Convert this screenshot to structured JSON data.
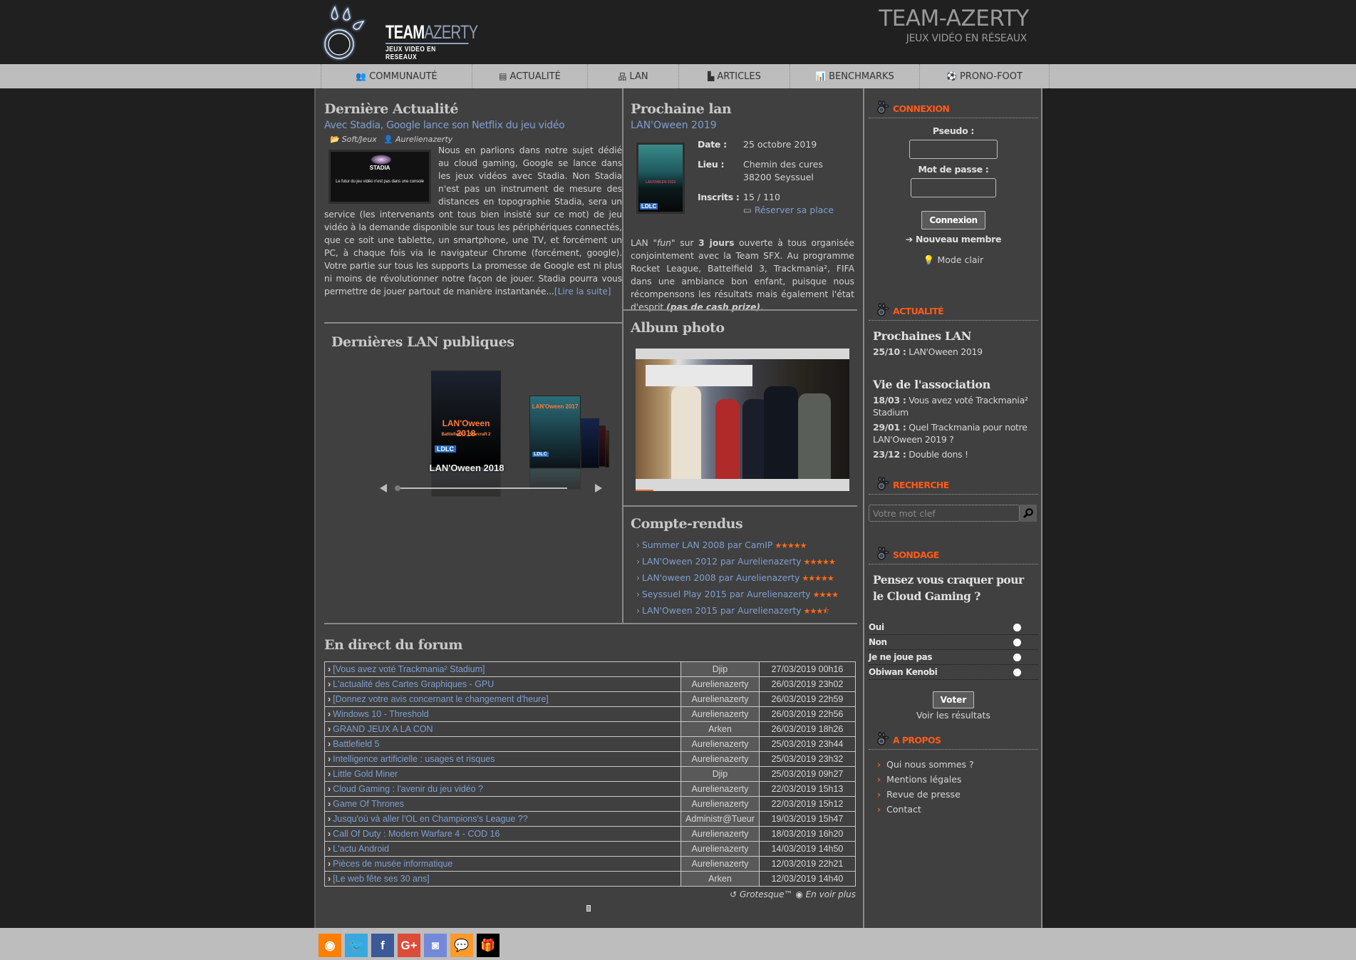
{
  "header": {
    "logo_word_team": "TEAM",
    "logo_word_azerty": "AZERTY",
    "logo_tagline": "JEUX VIDEO EN RESEAUX",
    "site_title": "TEAM-AZERTY",
    "site_subtitle": "JEUX VIDÉO EN RÉSEAUX"
  },
  "nav": {
    "items": [
      {
        "label": "COMMUNAUTÉ",
        "icon": "users-icon",
        "glyph": "👥"
      },
      {
        "label": "ACTUALITÉ",
        "icon": "newspaper-icon",
        "glyph": "▤"
      },
      {
        "label": "LAN",
        "icon": "sitemap-icon",
        "glyph": "品"
      },
      {
        "label": "ARTICLES",
        "icon": "book-reader-icon",
        "glyph": "▙"
      },
      {
        "label": "BENCHMARKS",
        "icon": "bar-chart-icon",
        "glyph": "📊"
      },
      {
        "label": "PRONO-FOOT",
        "icon": "soccer-ball-icon",
        "glyph": "⚽"
      }
    ]
  },
  "news": {
    "section_title": "Dernière Actualité",
    "headline": "Avec Stadia, Google lance son Netflix du jeu vidéo",
    "category": "Soft/Jeux",
    "author": "Aurelienazerty",
    "thumb_logo": "STADIA",
    "thumb_caption": "Le futur du jeu vidéo n'est pas dans une console",
    "body": "Nous en parlions dans notre sujet dédié au cloud gaming, Google se lance dans les jeux vidéos avec Stadia. Non Stadia n'est pas un instrument de mesure des distances en topographie Stadia, sera un service (les intervenants ont tous bien insisté sur ce mot) de jeu vidéo à la demande disponible sur tous les périphériques connectés, que ce soit une tablette, un smartphone, une TV, et forcément un PC, à chaque fois via le navigateur Chrome (forcément, google). Votre partie sur tous les supports La promesse de Google est ni plus ni moins de révolutionner notre façon de jouer. Stadia pourra vous permettre de jouer partout de manière instantanée...",
    "read_more": "[Lire la suite]"
  },
  "public_lans": {
    "section_title": "Dernières LAN publiques",
    "current_caption": "LAN'Oween 2018",
    "posters": [
      {
        "title": "LAN'Oween 2018"
      },
      {
        "title": "LAN'Oween 2017"
      }
    ]
  },
  "next_lan": {
    "section_title": "Prochaine lan",
    "name": "LAN'Oween 2019",
    "date_label": "Date :",
    "date_value": "25 octobre 2019",
    "place_label": "Lieu :",
    "place_line1": "Chemin des cures",
    "place_line2": "38200 Seyssuel",
    "registered_label": "Inscrits :",
    "registered_value": "15 / 110",
    "reserve_label": "Réserver sa place",
    "poster_title": "LAN'OWEEN 2019",
    "poster_sponsor": "LDLC",
    "desc_1": "LAN ",
    "desc_fun": "\"fun\"",
    "desc_2": " sur ",
    "desc_days": "3 jours",
    "desc_3": " ouverte à tous organisée conjointement avec la Team SFX. Au programme Rocket League, Battelfield 3, Trackmania², FIFA dans une ambiance bon enfant, puisque nous récompensons les résultats mais également l'état d'esprit ",
    "desc_cash": "(pas de cash prize)",
    "desc_end": "."
  },
  "album": {
    "section_title": "Album photo"
  },
  "reports": {
    "section_title": "Compte-rendus",
    "items": [
      {
        "label": "Summer LAN 2008 par CamIP",
        "rating": 5,
        "stars": "★★★★★"
      },
      {
        "label": "LAN'Oween 2012 par Aurelienazerty",
        "rating": 5,
        "stars": "★★★★★"
      },
      {
        "label": "LAN'oween 2008 par Aurelienazerty",
        "rating": 5,
        "stars": "★★★★★"
      },
      {
        "label": "Seyssuel Play 2015 par Aurelienazerty",
        "rating": 4,
        "stars": "★★★★"
      },
      {
        "label": "LAN'Oween 2015 par Aurelienazerty",
        "rating": 3.5,
        "stars": "★★★⯪"
      }
    ]
  },
  "forum": {
    "section_title": "En direct du forum",
    "rows": [
      {
        "topic": "[Vous avez voté Trackmania² Stadium]",
        "author": "Djip",
        "date": "27/03/2019 00h16"
      },
      {
        "topic": "L'actualité des Cartes Graphiques - GPU",
        "author": "Aurelienazerty",
        "date": "26/03/2019 23h02"
      },
      {
        "topic": "[Donnez votre avis concernant le changement d'heure]",
        "author": "Aurelienazerty",
        "date": "26/03/2019 22h59"
      },
      {
        "topic": "Windows 10 - Threshold",
        "author": "Aurelienazerty",
        "date": "26/03/2019 22h56"
      },
      {
        "topic": "GRAND JEUX A LA CON",
        "author": "Arken",
        "date": "26/03/2019 18h26"
      },
      {
        "topic": "Battlefield 5",
        "author": "Aurelienazerty",
        "date": "25/03/2019 23h44"
      },
      {
        "topic": "Intelligence artificielle : usages et risques",
        "author": "Aurelienazerty",
        "date": "25/03/2019 23h32"
      },
      {
        "topic": "Little Gold Miner",
        "author": "Djip",
        "date": "25/03/2019 09h27"
      },
      {
        "topic": "Cloud Gaming : l'avenir du jeu vidéo ?",
        "author": "Aurelienazerty",
        "date": "22/03/2019 15h13"
      },
      {
        "topic": "Game Of Thrones",
        "author": "Aurelienazerty",
        "date": "22/03/2019 15h12"
      },
      {
        "topic": "Jusqu'où và aller l'OL en Champions's League ??",
        "author": "Administr@Tueur",
        "date": "19/03/2019 15h47"
      },
      {
        "topic": "Call Of Duty : Modern Warfare 4 - COD 16",
        "author": "Aurelienazerty",
        "date": "18/03/2019 16h20"
      },
      {
        "topic": "L'actu Android",
        "author": "Aurelienazerty",
        "date": "14/03/2019 14h50"
      },
      {
        "topic": "Pièces de musée informatique",
        "author": "Aurelienazerty",
        "date": "12/03/2019 22h21"
      },
      {
        "topic": "[Le web fête ses 30 ans]",
        "author": "Arken",
        "date": "12/03/2019 14h40"
      }
    ],
    "footer_grotesque": "Grotesque™",
    "footer_more": "En voir plus"
  },
  "sidebar": {
    "login": {
      "title": "CONNEXION",
      "pseudo_label": "Pseudo :",
      "pseudo_value": "",
      "password_label": "Mot de passe :",
      "password_value": "",
      "submit": "Connexion",
      "new_member": "Nouveau membre",
      "light_mode": "Mode clair"
    },
    "news": {
      "title": "ACTUALITÉ",
      "next_lans_title": "Prochaines LAN",
      "next_lans": [
        {
          "date": "25/10 :",
          "text": "LAN'Oween 2019"
        }
      ],
      "assoc_title": "Vie de l'association",
      "assoc": [
        {
          "date": "18/03 :",
          "text": "Vous avez voté Trackmania² Stadium"
        },
        {
          "date": "29/01 :",
          "text": "Quel Trackmania pour notre LAN'Oween 2019 ?"
        },
        {
          "date": "23/12 :",
          "text": "Double dons !"
        }
      ]
    },
    "search": {
      "title": "RECHERCHE",
      "placeholder": "Votre mot clef",
      "value": ""
    },
    "poll": {
      "title": "SONDAGE",
      "question": "Pensez vous craquer pour le Cloud Gaming ?",
      "options": [
        "Oui",
        "Non",
        "Je ne joue pas",
        "Obiwan Kenobi"
      ],
      "vote": "Voter",
      "results": "Voir les résultats"
    },
    "about": {
      "title": "A PROPOS",
      "links": [
        "Qui nous sommes ?",
        "Mentions légales",
        "Revue de presse",
        "Contact"
      ]
    }
  },
  "footer": {
    "social": [
      {
        "name": "rss",
        "glyph": "◉",
        "color": "#ff8000"
      },
      {
        "name": "twitter",
        "glyph": "🐦",
        "color": "#3aa8df"
      },
      {
        "name": "facebook",
        "glyph": "f",
        "color": "#3b5998"
      },
      {
        "name": "google-plus",
        "glyph": "G+",
        "color": "#dd4b39"
      },
      {
        "name": "discord",
        "glyph": "◙",
        "color": "#7289da"
      },
      {
        "name": "chat",
        "glyph": "💬",
        "color": "#ff9a2a"
      },
      {
        "name": "gift",
        "glyph": "🎁",
        "color": "#000000"
      }
    ]
  },
  "colors": {
    "accent": "#ff5a1a",
    "link": "#7f9fcf",
    "panel": "#404040",
    "page": "#1f1f1f",
    "nav": "#bdbdbd"
  }
}
